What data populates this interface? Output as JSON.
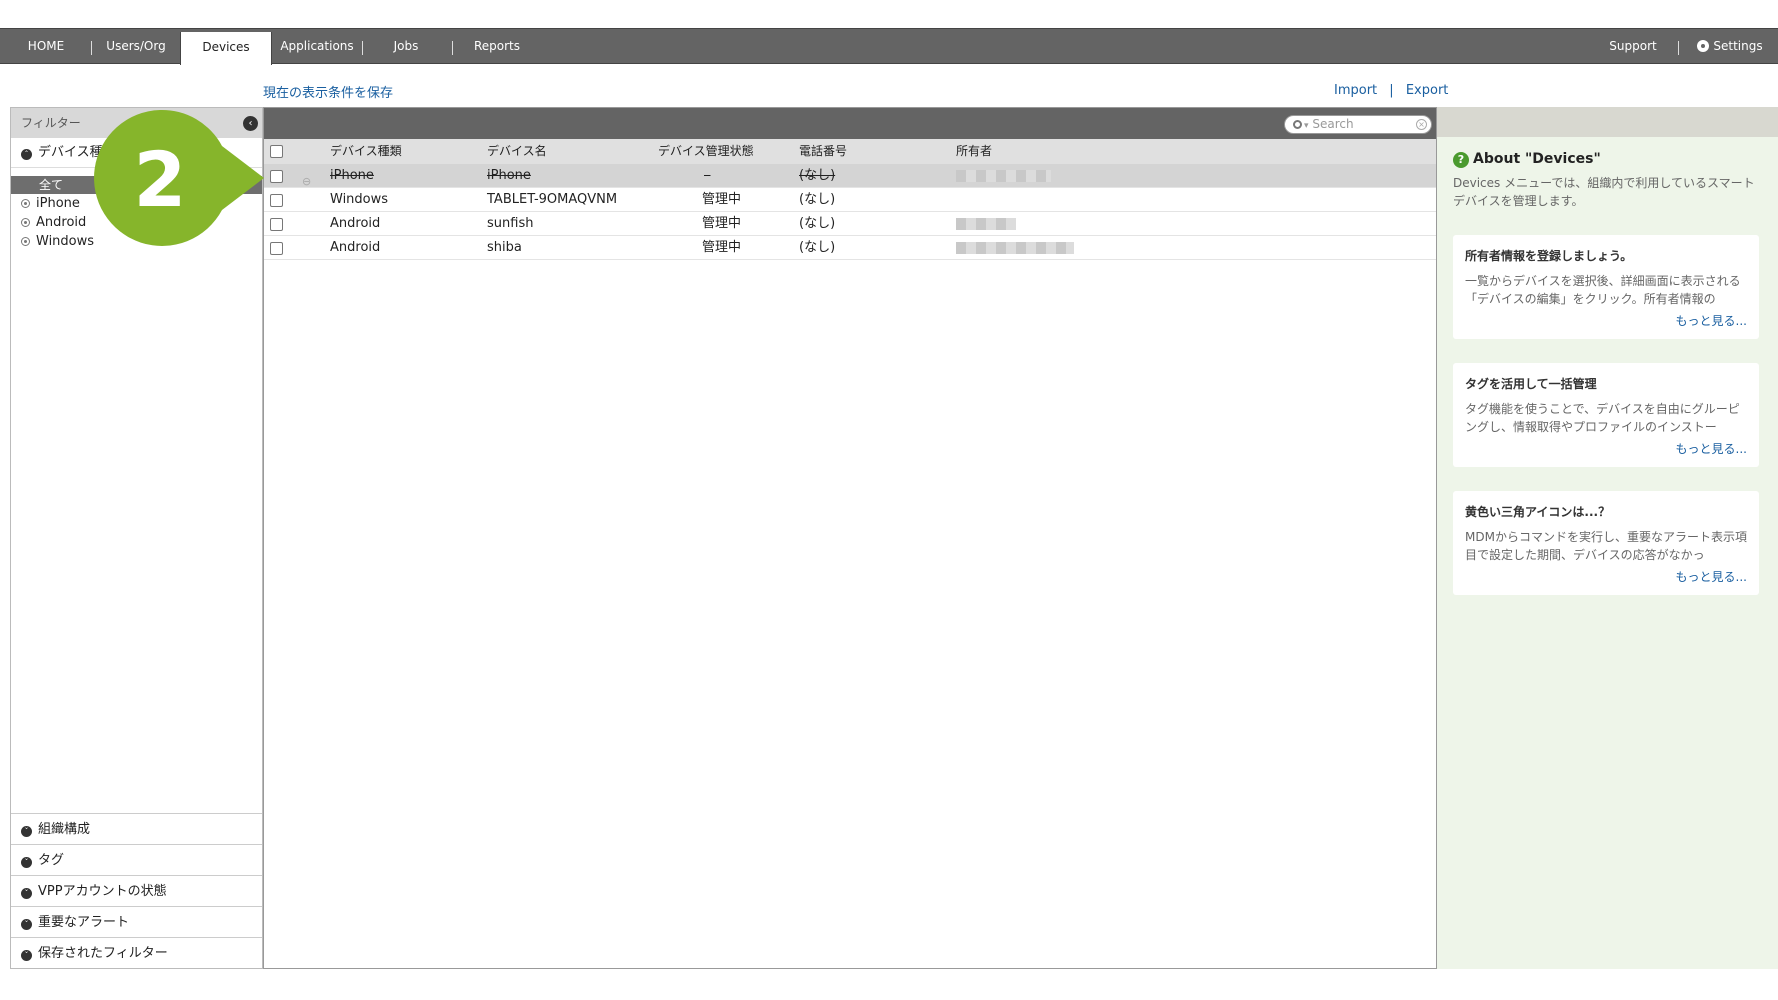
{
  "nav": {
    "home": "HOME",
    "users": "Users/Org",
    "devices": "Devices",
    "applications": "Applications",
    "jobs": "Jobs",
    "reports": "Reports",
    "support": "Support",
    "settings": "Settings"
  },
  "toolbar": {
    "save_view": "現在の表示条件を保存",
    "import": "Import",
    "sep": "|",
    "export": "Export"
  },
  "sidebar": {
    "header": "フィルター",
    "section_device_type": "デバイス種類",
    "selected": "全て",
    "options": [
      "iPhone",
      "Android",
      "Windows"
    ],
    "bottom": [
      "組織構成",
      "タグ",
      "VPPアカウントの状態",
      "重要なアラート",
      "保存されたフィルター"
    ]
  },
  "search": {
    "placeholder": "Search"
  },
  "table": {
    "headers": [
      "デバイス種類",
      "デバイス名",
      "デバイス管理状態",
      "電話番号",
      "所有者"
    ],
    "rows": [
      {
        "type": "iPhone",
        "name": "iPhone",
        "status": "–",
        "phone": "(なし)"
      },
      {
        "type": "Windows",
        "name": "TABLET-9OMAQVNM",
        "status": "管理中",
        "phone": "(なし)"
      },
      {
        "type": "Android",
        "name": "sunfish",
        "status": "管理中",
        "phone": "(なし)"
      },
      {
        "type": "Android",
        "name": "shiba",
        "status": "管理中",
        "phone": "(なし)"
      }
    ]
  },
  "right_panel": {
    "title": "About \"Devices\"",
    "desc": "Devices メニューでは、組織内で利用しているスマートデバイスを管理します。",
    "cards": [
      {
        "title": "所有者情報を登録しましょう。",
        "body": "一覧からデバイスを選択後、詳細画面に表示される「デバイスの編集」をクリック。所有者情報の",
        "more": "もっと見る..."
      },
      {
        "title": "タグを活用して一括管理",
        "body": "タグ機能を使うことで、デバイスを自由にグルーピングし、情報取得やプロファイルのインストー",
        "more": "もっと見る..."
      },
      {
        "title": "黄色い三角アイコンは...？",
        "body": "MDMからコマンドを実行し、重要なアラート表示項目で設定した期間、デバイスの応答がなかっ",
        "more": "もっと見る..."
      }
    ]
  },
  "callout": {
    "number": "2"
  },
  "colors": {
    "nav_bg": "#646464",
    "link": "#1a5fa0",
    "callout": "#86b52b",
    "help_green": "#4a9a2e"
  }
}
